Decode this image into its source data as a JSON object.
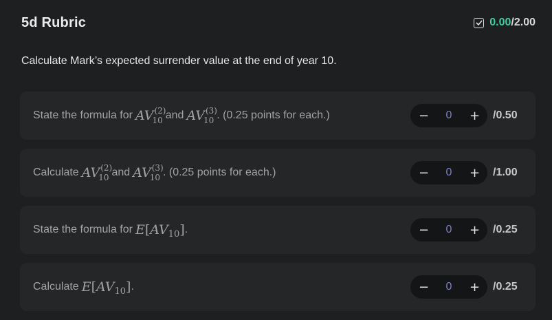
{
  "header": {
    "title": "5d Rubric",
    "score_earned": "0.00",
    "score_total": "/2.00",
    "status_icon": "check-square-icon"
  },
  "question": "Calculate Mark’s expected surrender value at the end of year 10.",
  "criteria": [
    {
      "prefix": "State the formula for",
      "mid": "and",
      "suffix": ". (0.25 points for each.)",
      "value": "0",
      "max": "/0.50"
    },
    {
      "prefix": "Calculate",
      "mid": "and",
      "suffix": ". (0.25 points for each.)",
      "value": "0",
      "max": "/1.00"
    },
    {
      "prefix": "State the formula for",
      "suffix": ".",
      "value": "0",
      "max": "/0.25"
    },
    {
      "prefix": "Calculate",
      "suffix": ".",
      "value": "0",
      "max": "/0.25"
    }
  ],
  "math": {
    "av": "AV",
    "sub10": "10",
    "sup2": "(2)",
    "sup3": "(3)",
    "e": "E",
    "lb": "[",
    "rb": "]"
  },
  "stepper": {
    "minus": "−",
    "plus": "+"
  }
}
